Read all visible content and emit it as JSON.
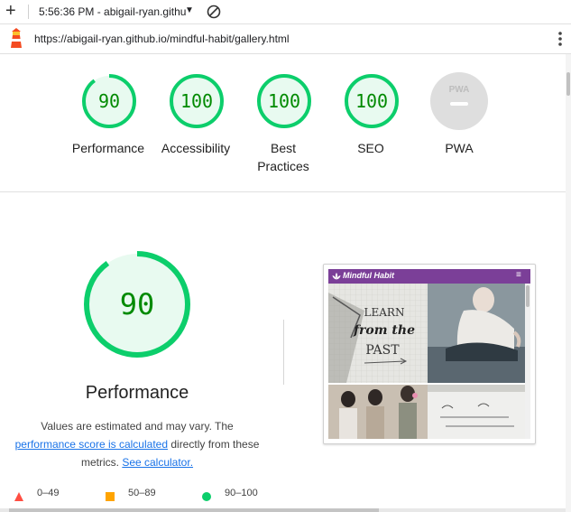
{
  "toolbar": {
    "time_info": "5:56:36 PM - abigail-ryan.githu",
    "icons": [
      "plus-icon",
      "caret-down-icon",
      "block-icon"
    ]
  },
  "address": {
    "url": "https://abigail-ryan.github.io/mindful-habit/gallery.html"
  },
  "summary": [
    {
      "score": "90",
      "score_value": 90,
      "label": "Performance",
      "color": "#0cce6b"
    },
    {
      "score": "100",
      "score_value": 100,
      "label": "Accessibility",
      "color": "#0cce6b"
    },
    {
      "score": "100",
      "score_value": 100,
      "label_lines": [
        "Best",
        "Practices"
      ],
      "color": "#0cce6b"
    },
    {
      "score": "100",
      "score_value": 100,
      "label": "SEO",
      "color": "#0cce6b"
    },
    {
      "badge": "PWA",
      "label": "PWA",
      "color": "#cccccc"
    }
  ],
  "performance": {
    "score": "90",
    "score_value": 90,
    "title": "Performance",
    "desc_1": "Values are estimated and may vary. The",
    "desc_link_1": "performance score is calculated",
    "desc_2": " directly from these",
    "desc_3": "metrics. ",
    "desc_link_2": "See calculator."
  },
  "screenshot": {
    "brand": "Mindful Habit",
    "tile_texts": [
      "LEARN",
      "from the",
      "PAST"
    ],
    "menu_icon": "hamburger-icon"
  },
  "legend": [
    {
      "range": "0–49",
      "color": "#ff4e42",
      "shape": "triangle"
    },
    {
      "range": "50–89",
      "color": "#ffa400",
      "shape": "square"
    },
    {
      "range": "90–100",
      "color": "#0cce6b",
      "shape": "circle"
    }
  ]
}
